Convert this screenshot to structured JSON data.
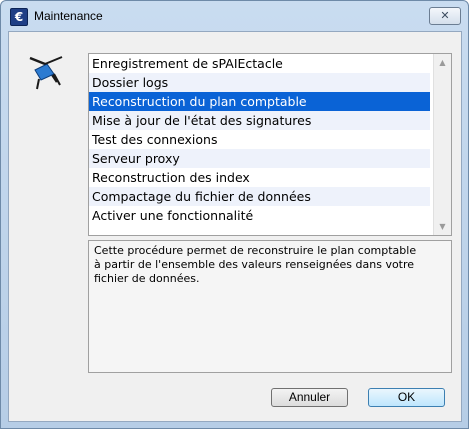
{
  "window": {
    "title": "Maintenance",
    "app_icon": "euro-app-icon",
    "close_label": "✕"
  },
  "list": {
    "items": [
      "Enregistrement de sPAIEctacle",
      "Dossier logs",
      "Reconstruction du plan comptable",
      "Mise à jour de l'état des signatures",
      "Test des connexions",
      "Serveur proxy",
      "Reconstruction des index",
      "Compactage du fichier de données",
      "Activer une fonctionnalité"
    ],
    "selected_index": 2
  },
  "description": {
    "text": "Cette procédure permet de reconstruire le plan comptable\nà partir de l'ensemble des valeurs renseignées dans votre\nfichier de données."
  },
  "buttons": {
    "cancel_label": "Annuler",
    "ok_label": "OK"
  },
  "colors": {
    "selection": "#0a63d6",
    "alt_row": "#eef2fb"
  }
}
